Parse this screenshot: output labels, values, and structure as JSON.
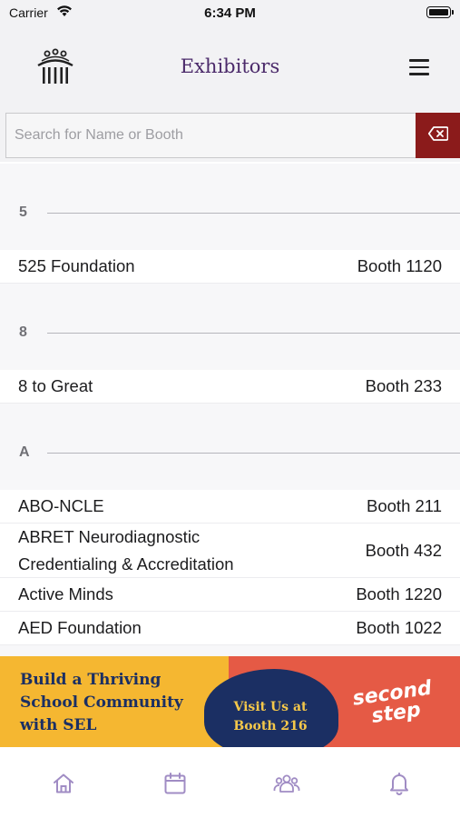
{
  "status_bar": {
    "carrier": "Carrier",
    "time": "6:34 PM"
  },
  "header": {
    "title": "Exhibitors"
  },
  "search": {
    "placeholder": "Search for Name or Booth",
    "value": ""
  },
  "sections": [
    {
      "letter": "5",
      "rows": [
        {
          "name": "525 Foundation",
          "booth": "Booth 1120"
        }
      ]
    },
    {
      "letter": "8",
      "rows": [
        {
          "name": "8 to Great",
          "booth": "Booth 233"
        }
      ]
    },
    {
      "letter": "A",
      "rows": [
        {
          "name": "ABO-NCLE",
          "booth": "Booth 211"
        },
        {
          "name": "ABRET Neurodiagnostic Credentialing & Accreditation",
          "booth": "Booth 432"
        },
        {
          "name": "Active Minds",
          "booth": "Booth 1220"
        },
        {
          "name": "AED Foundation",
          "booth": "Booth 1022"
        }
      ]
    }
  ],
  "banner": {
    "headline_lines": [
      "Build a Thriving",
      "School Community",
      "with SEL"
    ],
    "cta_lines": [
      "Visit Us at",
      "Booth 216"
    ],
    "brand_lines": [
      "second",
      "step"
    ]
  },
  "tab_bar": {
    "icons": [
      "home-icon",
      "calendar-icon",
      "people-icon",
      "bell-icon"
    ]
  },
  "colors": {
    "title": "#4b2a6a",
    "clear_button": "#8b1b1b",
    "tab_icon": "#a08cc4",
    "banner_yellow": "#f5b731",
    "banner_red": "#e55a45",
    "banner_navy": "#1b2f63"
  }
}
